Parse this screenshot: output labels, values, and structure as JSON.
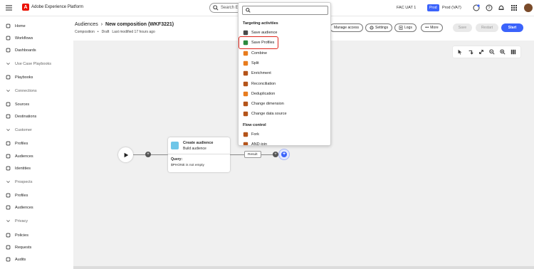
{
  "topbar": {
    "logo_letter": "A",
    "app_title": "Adobe Experience Platform",
    "search_placeholder": "Search Ex",
    "org": "FAC UAT 1",
    "sandbox_tag": "Prod",
    "sandbox_name": "Prod (VA7)",
    "icons": [
      "grid-icon",
      "help-icon",
      "bell-icon",
      "apps-icon",
      "avatar"
    ]
  },
  "sidebar": {
    "items": [
      {
        "label": "Home",
        "icon": "home-icon"
      },
      {
        "label": "Workflows",
        "icon": "workflow-icon"
      },
      {
        "label": "Dashboards",
        "icon": "dashboard-icon"
      },
      {
        "label": "Use Case Playbooks",
        "icon": "chevron-icon",
        "group": true
      },
      {
        "label": "Playbooks",
        "icon": "playbook-icon"
      },
      {
        "label": "Connections",
        "icon": "chevron-icon",
        "group": true
      },
      {
        "label": "Sources",
        "icon": "source-icon"
      },
      {
        "label": "Destinations",
        "icon": "destination-icon"
      },
      {
        "label": "Customer",
        "icon": "chevron-icon",
        "group": true
      },
      {
        "label": "Profiles",
        "icon": "profile-icon"
      },
      {
        "label": "Audiences",
        "icon": "audience-icon"
      },
      {
        "label": "Identities",
        "icon": "identity-icon"
      },
      {
        "label": "Prospects",
        "icon": "chevron-icon",
        "group": true
      },
      {
        "label": "Profiles",
        "icon": "profile-icon"
      },
      {
        "label": "Audiences",
        "icon": "audience-icon"
      },
      {
        "label": "Privacy",
        "icon": "chevron-icon",
        "group": true
      },
      {
        "label": "Policies",
        "icon": "policy-icon"
      },
      {
        "label": "Requests",
        "icon": "request-icon"
      },
      {
        "label": "Audits",
        "icon": "audit-icon"
      }
    ]
  },
  "header": {
    "breadcrumb_root": "Audiences",
    "breadcrumb_sep": "›",
    "title": "New composition (WKF3221)",
    "meta_type": "Composition",
    "meta_status": "Draft",
    "meta_modified": "Last modified 17 hours ago",
    "buttons": {
      "manage_access": "Manage access",
      "settings": "Settings",
      "logs": "Logs",
      "more": "More",
      "save": "Save",
      "restart": "Restart",
      "start": "Start"
    }
  },
  "canvas": {
    "card": {
      "title": "Create audience",
      "subtitle": "Build audience",
      "query_label": "Query:",
      "query_value": "$PHONE is not empty"
    },
    "result_label": "Result"
  },
  "popover": {
    "search_value": "",
    "section_targeting": "Targeting activities",
    "targeting_items": [
      {
        "label": "Save audience",
        "icon": "save-audience-icon"
      },
      {
        "label": "Save Profiles",
        "icon": "save-profiles-icon",
        "highlighted": true
      },
      {
        "label": "Combine",
        "icon": "combine-icon"
      },
      {
        "label": "Split",
        "icon": "split-icon"
      },
      {
        "label": "Enrichment",
        "icon": "enrichment-icon"
      },
      {
        "label": "Reconciliation",
        "icon": "reconciliation-icon"
      },
      {
        "label": "Deduplication",
        "icon": "deduplication-icon"
      },
      {
        "label": "Change dimension",
        "icon": "change-dimension-icon"
      },
      {
        "label": "Change data source",
        "icon": "change-data-source-icon"
      }
    ],
    "section_flow": "Flow control",
    "flow_items": [
      {
        "label": "Fork",
        "icon": "fork-icon"
      },
      {
        "label": "AND-join",
        "icon": "and-join-icon"
      }
    ]
  },
  "colors": {
    "accent": "#3b63fb",
    "highlight": "#e0251b",
    "adobe_red": "#eb1000"
  }
}
